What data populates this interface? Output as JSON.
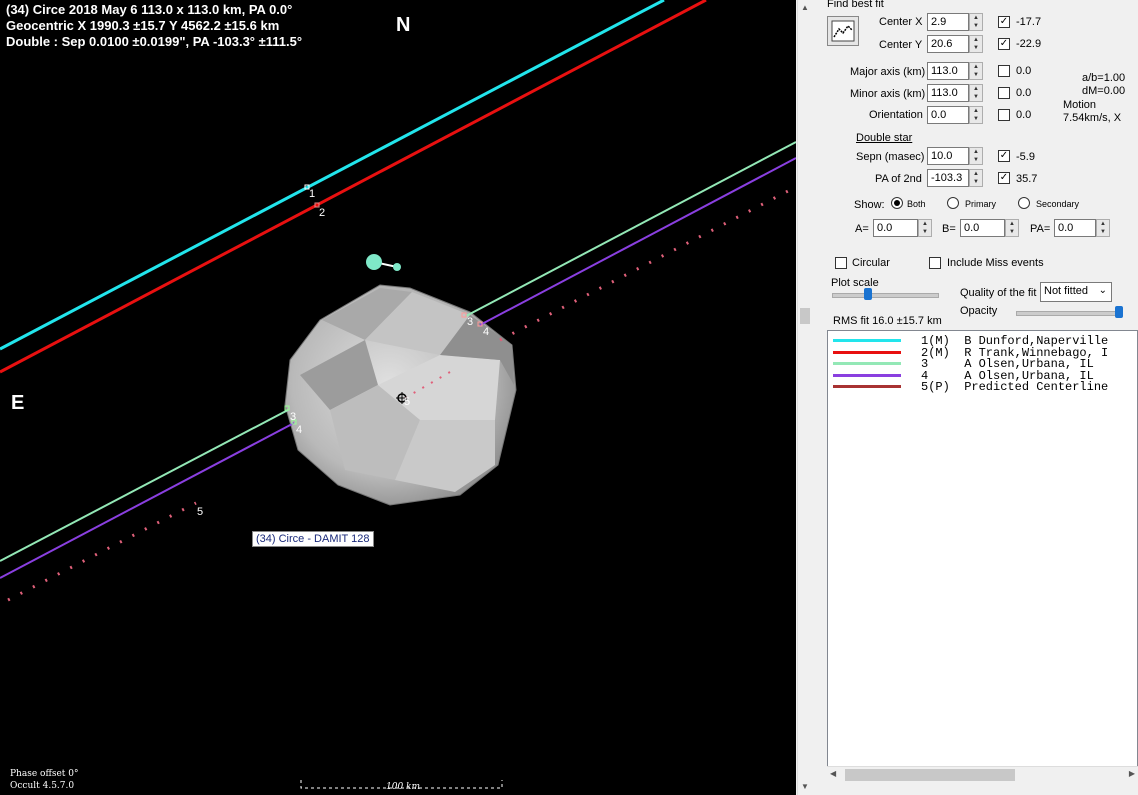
{
  "plot": {
    "header_line1": "(34) Circe  2018 May 6   113.0 x 113.0 km, PA 0.0°",
    "header_line2": "Geocentric  X  1990.3 ±15.7  Y 4562.2 ±15.6 km",
    "header_line3": "Double : Sep  0.0100 ±0.0199\", PA -103.3° ±111.5°",
    "north_label": "N",
    "east_label": "E",
    "asteroid_label": "(34) Circe - DAMIT 128",
    "phase_offset": "Phase offset 0°",
    "version": "Occult 4.5.7.0",
    "scale_label": "100 km",
    "chord_labels": {
      "c1": "1",
      "c2": "2",
      "c3a": "3",
      "c4a": "4",
      "c3b": "3",
      "c4b": "4",
      "c5a": "5",
      "c5b": "5"
    }
  },
  "panel": {
    "find_best_fit": "Find best fit",
    "center_x_label": "Center X",
    "center_x_value": "2.9",
    "center_x_check_value": "-17.7",
    "center_y_label": "Center Y",
    "center_y_value": "20.6",
    "center_y_check_value": "-22.9",
    "major_axis_label": "Major axis (km)",
    "major_axis_value": "113.0",
    "major_axis_check_value": "0.0",
    "minor_axis_label": "Minor axis (km)",
    "minor_axis_value": "113.0",
    "minor_axis_check_value": "0.0",
    "orientation_label": "Orientation",
    "orientation_value": "0.0",
    "orientation_check_value": "0.0",
    "ab_ratio": "a/b=1.00",
    "dm": "dM=0.00",
    "motion_label": "Motion",
    "motion_value": "7.54km/s, X",
    "double_star_label": "Double star",
    "sepn_label": "Sepn (masec)",
    "sepn_value": "10.0",
    "sepn_check_value": "-5.9",
    "pa2_label": "PA of 2nd",
    "pa2_value": "-103.3",
    "pa2_check_value": "35.7",
    "show_label": "Show:",
    "show_both": "Both",
    "show_primary": "Primary",
    "show_secondary": "Secondary",
    "a_label": "A=",
    "a_value": "0.0",
    "b_label": "B=",
    "b_value": "0.0",
    "pa_label": "PA=",
    "pa_value": "0.0",
    "circular_label": "Circular",
    "include_miss_label": "Include Miss events",
    "plot_scale_label": "Plot scale",
    "quality_label": "Quality of the fit",
    "quality_value": "Not fitted",
    "opacity_label": "Opacity",
    "rms_fit": "RMS fit 16.0 ±15.7 km"
  },
  "legend": [
    {
      "text": "1(M)  B Dunford,Naperville",
      "color": "#22e5ec"
    },
    {
      "text": "2(M)  R Trank,Winnebago, I",
      "color": "#e81010"
    },
    {
      "text": "3     A Olsen,Urbana, IL",
      "color": "#93e8b6"
    },
    {
      "text": "4     A Olsen,Urbana, IL",
      "color": "#8a3fe0"
    },
    {
      "text": "5(P)  Predicted Centerline",
      "color": "#a83232"
    }
  ],
  "colors": {
    "chord1": "#22e5ec",
    "chord2": "#e81010",
    "chord3": "#93e8b6",
    "chord4": "#8a3fe0",
    "centerline": "#e0607a",
    "plot_background": "#000000",
    "panel_background": "#f0f0f0",
    "slider_knob": "#1a73d1"
  }
}
